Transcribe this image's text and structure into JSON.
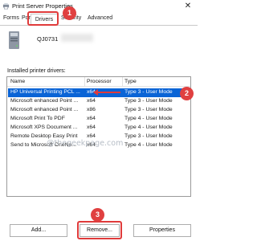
{
  "window": {
    "title": "Print Server Properties",
    "close_glyph": "✕"
  },
  "tabs": [
    {
      "label": "Forms"
    },
    {
      "label": "Ports"
    },
    {
      "label": "Drivers",
      "active": true
    },
    {
      "label": "Security"
    },
    {
      "label": "Advanced"
    }
  ],
  "server": {
    "name": "QJ0731",
    "icon": "printer-server-icon"
  },
  "drivers": {
    "caption": "Installed printer drivers:",
    "columns": [
      "Name",
      "Processor",
      "Type"
    ],
    "rows": [
      {
        "name": "HP Universal Printing PCL ...",
        "processor": "x64",
        "type": "Type 3 - User Mode",
        "selected": true
      },
      {
        "name": "Microsoft enhanced Point ...",
        "processor": "x64",
        "type": "Type 3 - User Mode"
      },
      {
        "name": "Microsoft enhanced Point ...",
        "processor": "x86",
        "type": "Type 3 - User Mode"
      },
      {
        "name": "Microsoft Print To PDF",
        "processor": "x64",
        "type": "Type 4 - User Mode"
      },
      {
        "name": "Microsoft XPS Document ...",
        "processor": "x64",
        "type": "Type 4 - User Mode"
      },
      {
        "name": "Remote Desktop Easy Print",
        "processor": "x64",
        "type": "Type 3 - User Mode"
      },
      {
        "name": "Send to Microsoft OneNo...",
        "processor": "x64",
        "type": "Type 4 - User Mode"
      }
    ]
  },
  "watermark": "@thegeekpage.com",
  "buttons": {
    "add": "Add...",
    "remove": "Remove...",
    "properties": "Properties"
  },
  "annotations": {
    "badge_1": "1",
    "badge_2": "2",
    "badge_3": "3",
    "color": "#e03b3b"
  },
  "colors": {
    "selection": "#0a64d6",
    "badge": "#e04040"
  }
}
